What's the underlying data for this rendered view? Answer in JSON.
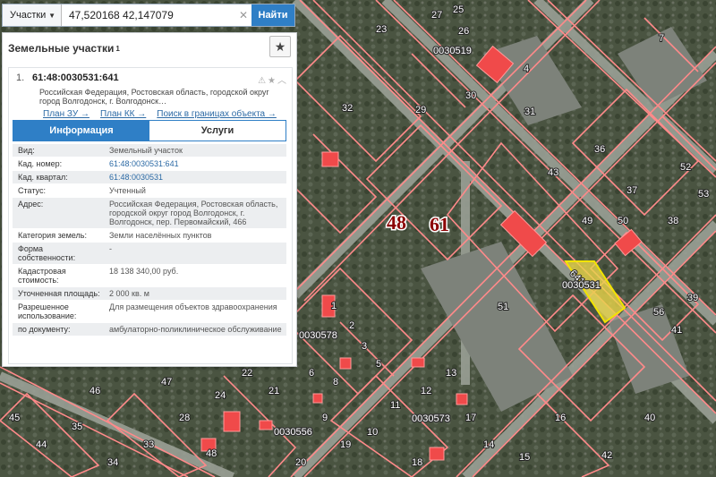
{
  "search": {
    "dropdown_label": "Участки",
    "query": "47,520168 42,147079",
    "button_label": "Найти"
  },
  "panel": {
    "title": "Земельные участки",
    "count": "1",
    "result": {
      "index": "1.",
      "cad_number": "61:48:0030531:641",
      "address_short": "Российская Федерация, Ростовская область, городской округ город Волгодонск, г. Волгодонск…",
      "links": [
        "План ЗУ →",
        "План КК →",
        "Поиск в границах объекта →"
      ]
    },
    "tabs": [
      "Информация",
      "Услуги"
    ],
    "rows": [
      {
        "key": "Вид:",
        "value": "Земельный участок"
      },
      {
        "key": "Кад. номер:",
        "value": "61:48:0030531:641"
      },
      {
        "key": "Кад. квартал:",
        "value": "61:48:0030531"
      },
      {
        "key": "Статус:",
        "value": "Учтенный"
      },
      {
        "key": "Адрес:",
        "value": "Российская Федерация, Ростовская область, городской округ город Волгодонск, г. Волгодонск, пер. Первомайский, 466"
      },
      {
        "key": "Категория земель:",
        "value": "Земли населённых пунктов"
      },
      {
        "key": "Форма собственности:",
        "value": "-"
      },
      {
        "key": "Кадастровая стоимость:",
        "value": "18 138 340,00 руб."
      },
      {
        "key": "Уточненная площадь:",
        "value": "2 000 кв. м"
      },
      {
        "key": "Разрешенное использование:",
        "value": "Для размещения объектов здравоохранения"
      },
      {
        "key": "по документу:",
        "value": "амбулаторно-поликлиническое обслуживание"
      }
    ]
  },
  "map": {
    "block_labels": [
      "0030519",
      "0030578",
      "0030573",
      "0030556"
    ],
    "highlight_label": "0030531",
    "highlight_number": "641",
    "district_labels": [
      "48",
      "61"
    ],
    "building_numbers": [
      "25",
      "23",
      "26",
      "27",
      "7",
      "4",
      "29",
      "30",
      "31",
      "32",
      "36",
      "37",
      "38",
      "39",
      "41",
      "40",
      "42",
      "43",
      "51",
      "56",
      "1",
      "2",
      "3",
      "5",
      "6",
      "8",
      "9",
      "10",
      "11",
      "12",
      "13",
      "14",
      "15",
      "16",
      "17",
      "18",
      "19",
      "20",
      "21",
      "22",
      "24",
      "28",
      "33",
      "34",
      "35",
      "44",
      "45",
      "46",
      "47",
      "48",
      "49",
      "50",
      "52",
      "53"
    ],
    "colors": {
      "parcel_line": "#ff8a8a",
      "highlight_fill": "#e8d44a",
      "highlight_line": "#f2e400",
      "building_fill": "#f04a4a",
      "block_text": "#ffffff"
    }
  }
}
